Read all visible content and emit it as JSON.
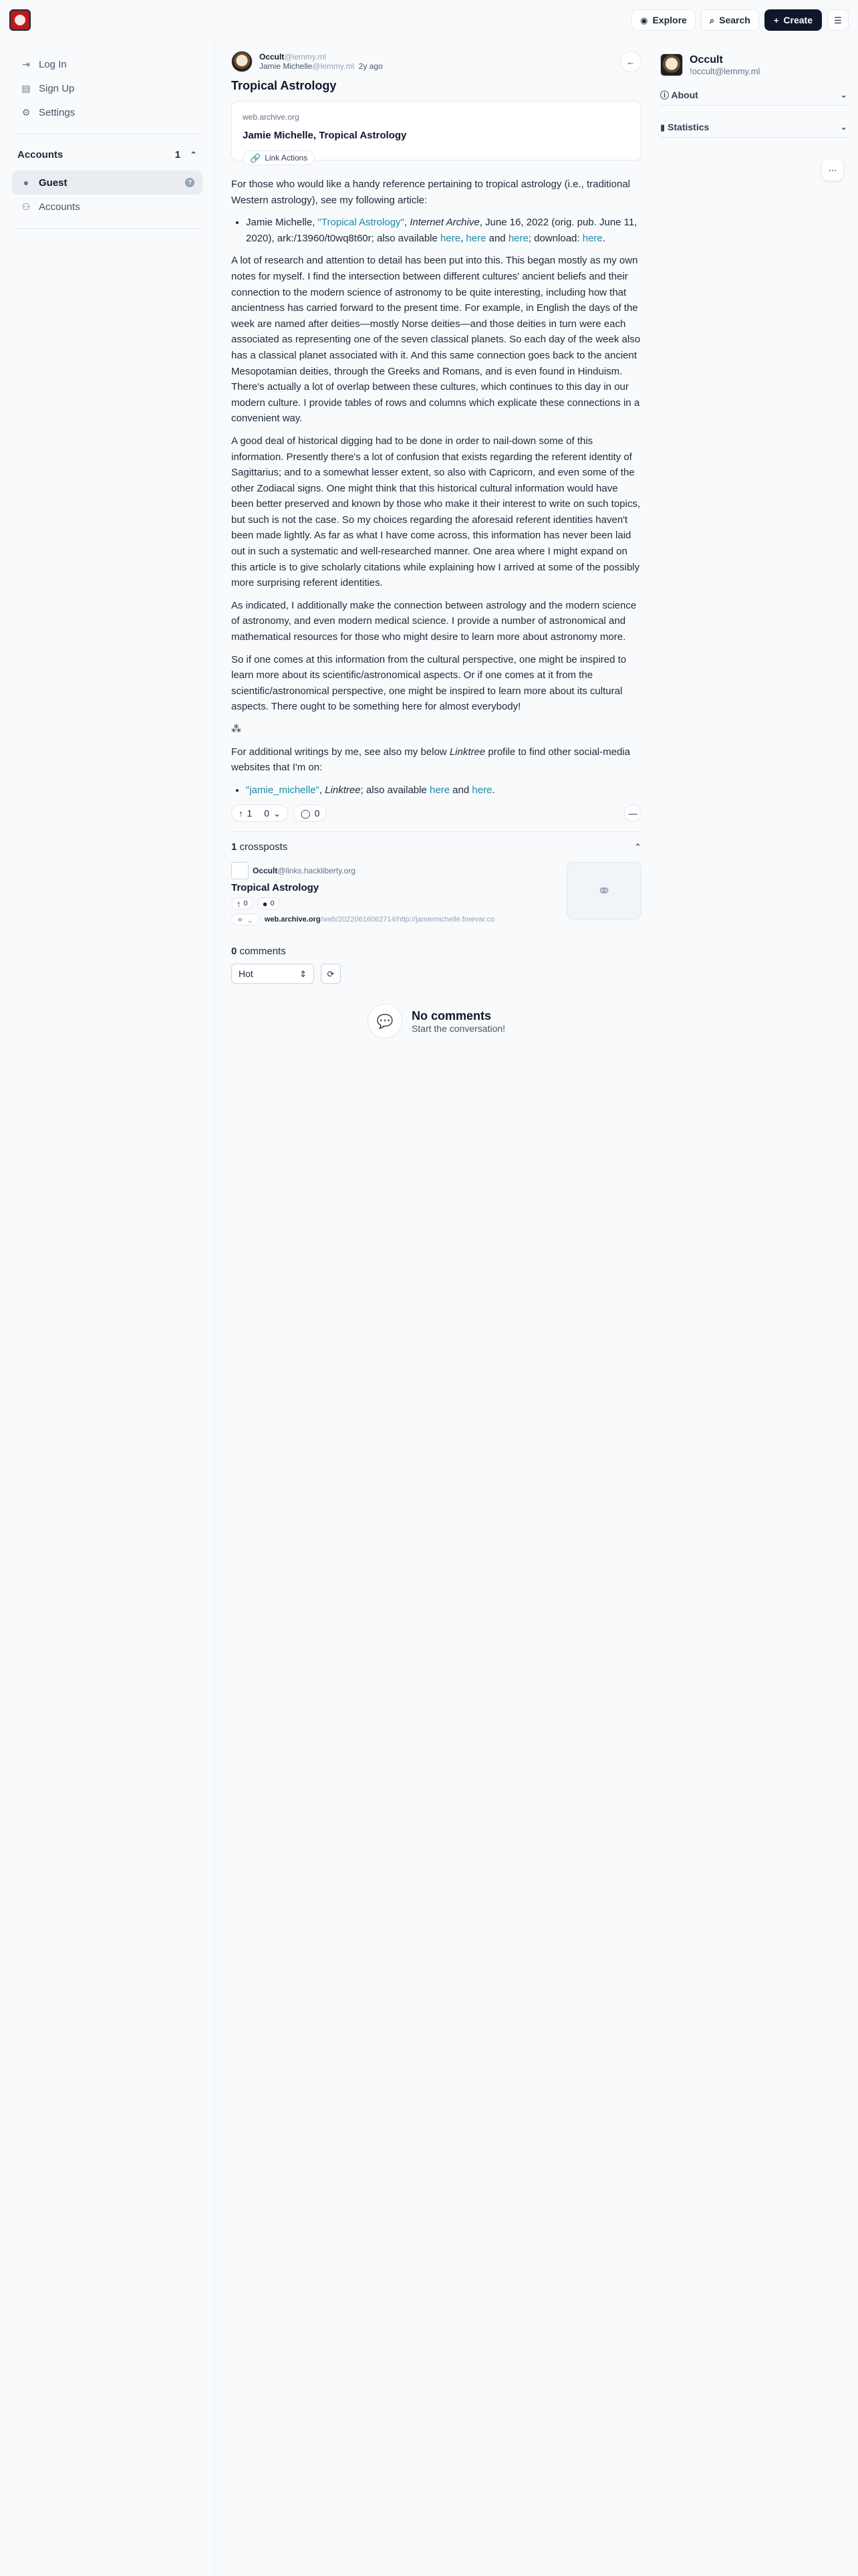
{
  "topbar": {
    "explore": "Explore",
    "search": "Search",
    "create": "Create"
  },
  "sidebar": {
    "login": "Log In",
    "signup": "Sign Up",
    "settings": "Settings",
    "accounts_label": "Accounts",
    "accounts_count": "1",
    "guest": "Guest",
    "accounts_link": "Accounts"
  },
  "post": {
    "community": "Occult",
    "community_instance": "@lemmy.ml",
    "author": "Jamie Michelle",
    "author_instance": "@lemmy.ml",
    "age": "2y ago",
    "title": "Tropical Astrology",
    "link_host": "web.archive.org",
    "link_title": "Jamie Michelle, Tropical Astrology",
    "link_actions": "Link Actions",
    "p1": "For those who would like a handy reference pertaining to tropical astrology (i.e., traditional Western astrology), see my following article:",
    "li1_a": "Jamie Michelle, ",
    "li1_link": "\"Tropical Astrology\"",
    "li1_b": ", ",
    "li1_em": "Internet Archive",
    "li1_c": ", June 16, 2022 (orig. pub. June 11, 2020), ark:/13960/t0wq8t60r; also available ",
    "li1_here1": "here",
    "li1_comma": ", ",
    "li1_here2": "here",
    "li1_and": " and ",
    "li1_here3": "here",
    "li1_dl": "; download: ",
    "li1_here4": "here",
    "li1_end": ".",
    "p2": "A lot of research and attention to detail has been put into this. This began mostly as my own notes for myself. I find the intersection between different cultures' ancient beliefs and their connection to the modern science of astronomy to be quite interesting, including how that ancientness has carried forward to the present time. For example, in English the days of the week are named after deities—mostly Norse deities—and those deities in turn were each associated as representing one of the seven classical planets. So each day of the week also has a classical planet associated with it. And this same connection goes back to the ancient Mesopotamian deities, through the Greeks and Romans, and is even found in Hinduism. There's actually a lot of overlap between these cultures, which continues to this day in our modern culture. I provide tables of rows and columns which explicate these connections in a convenient way.",
    "p3": "A good deal of historical digging had to be done in order to nail-down some of this information. Presently there's a lot of confusion that exists regarding the referent identity of Sagittarius; and to a somewhat lesser extent, so also with Capricorn, and even some of the other Zodiacal signs. One might think that this historical cultural information would have been better preserved and known by those who make it their interest to write on such topics, but such is not the case. So my choices regarding the aforesaid referent identities haven't been made lightly. As far as what I have come across, this information has never been laid out in such a systematic and well-researched manner. One area where I might expand on this article is to give scholarly citations while explaining how I arrived at some of the possibly more surprising referent identities.",
    "p4": "As indicated, I additionally make the connection between astrology and the modern science of astronomy, and even modern medical science. I provide a number of astronomical and mathematical resources for those who might desire to learn more about astronomy more.",
    "p5": "So if one comes at this information from the cultural perspective, one might be inspired to learn more about its scientific/astronomical aspects. Or if one comes at it from the scientific/astronomical perspective, one might be inspired to learn more about its cultural aspects. There ought to be something here for almost everybody!",
    "symbol": "⁂",
    "p6_a": "For additional writings by me, see also my below ",
    "p6_em": "Linktree",
    "p6_b": " profile to find other social-media websites that I'm on:",
    "li2_link": "\"jamie_michelle\"",
    "li2_a": ", ",
    "li2_em": "Linktree",
    "li2_b": "; also available ",
    "li2_here1": "here",
    "li2_and": " and ",
    "li2_here2": "here",
    "li2_end": ".",
    "upvotes": "1",
    "downvotes": "0",
    "comments": "0"
  },
  "crossposts": {
    "count": "1",
    "label": "crossposts",
    "community": "Occult",
    "instance": "@links.hackliberty.org",
    "title": "Tropical Astrology",
    "up": "0",
    "comments": "0",
    "url_host": "web.archive.org",
    "url_path": "/web/20220616062714/http://jamiemichelle.freevar.co"
  },
  "comments": {
    "count": "0",
    "label": "comments",
    "sort": "Hot",
    "empty_title": "No comments",
    "empty_sub": "Start the conversation!"
  },
  "community": {
    "name": "Occult",
    "handle": "!occult@lemmy.ml",
    "about": "About",
    "statistics": "Statistics"
  }
}
